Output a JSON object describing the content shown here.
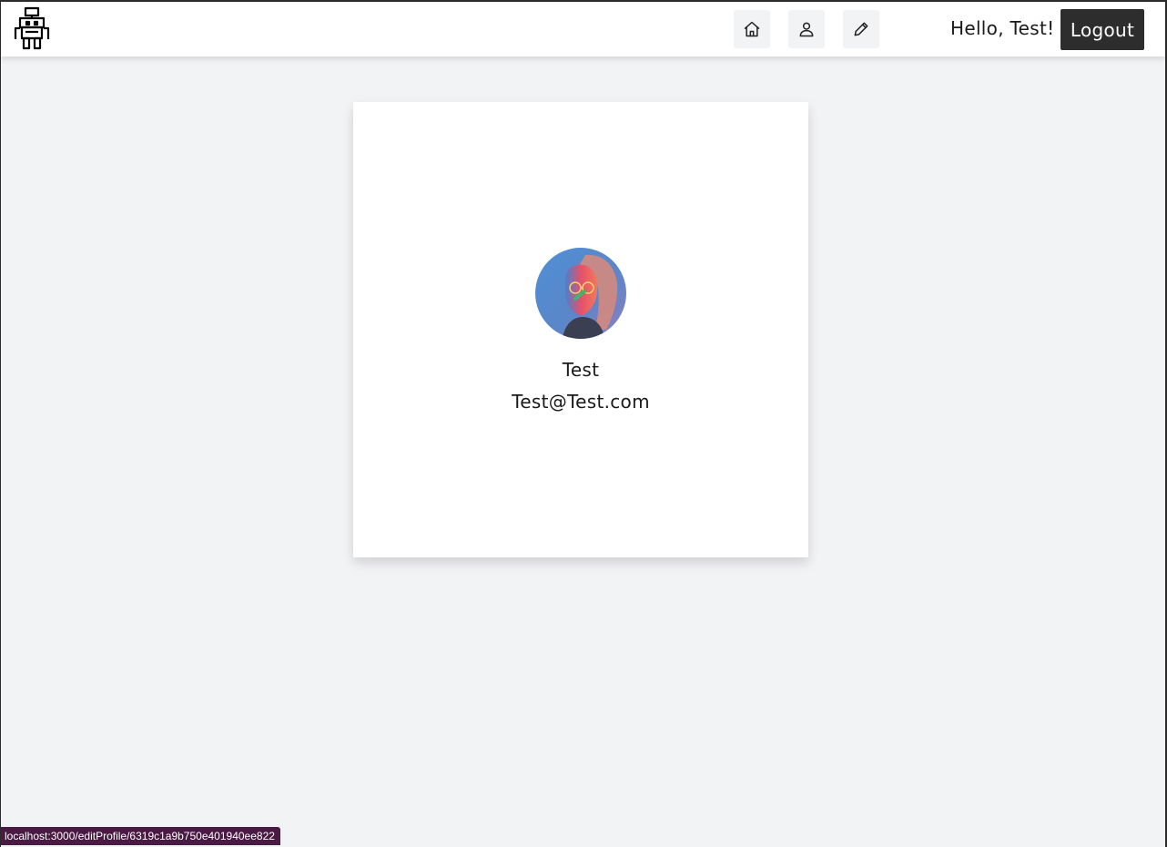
{
  "header": {
    "logo_icon": "robot-icon",
    "nav": [
      {
        "icon": "home-icon"
      },
      {
        "icon": "user-icon"
      },
      {
        "icon": "pencil-icon"
      }
    ],
    "greeting": "Hello, Test!",
    "logout_label": "Logout"
  },
  "profile": {
    "avatar_icon": "profile-photo",
    "name": "Test",
    "email": "Test@Test.com"
  },
  "status_bar": {
    "url": "localhost:3000/editProfile/6319c1a9b750e401940ee822"
  },
  "colors": {
    "page_background": "#f2f3f5",
    "navbar_background": "#ffffff",
    "button_background": "#f2f3f5",
    "logout_background": "#2d2d2d",
    "status_bar_background": "#4a1a44"
  }
}
